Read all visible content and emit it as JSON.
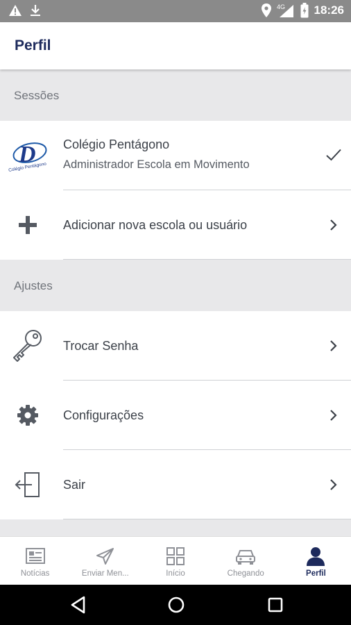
{
  "status_bar": {
    "time": "18:26",
    "network": "4G"
  },
  "app_bar": {
    "title": "Perfil"
  },
  "sections": {
    "sessions_header": "Sessões",
    "settings_header": "Ajustes"
  },
  "session": {
    "logo_alt": "Colégio Pentágono",
    "school_name": "Colégio Pentágono",
    "role": "Administrador Escola em Movimento"
  },
  "add_school": {
    "label": "Adicionar nova escola ou usuário"
  },
  "settings_items": [
    {
      "label": "Trocar Senha",
      "icon": "key-icon"
    },
    {
      "label": "Configurações",
      "icon": "gear-icon"
    },
    {
      "label": "Sair",
      "icon": "logout-icon"
    }
  ],
  "bottom_nav": [
    {
      "label": "Notícias",
      "icon": "newspaper-icon"
    },
    {
      "label": "Enviar Men...",
      "icon": "send-icon"
    },
    {
      "label": "Início",
      "icon": "grid-icon"
    },
    {
      "label": "Chegando",
      "icon": "car-icon"
    },
    {
      "label": "Perfil",
      "icon": "person-icon",
      "active": true
    }
  ],
  "colors": {
    "primary": "#1d2a5c",
    "section_bg": "#e8e8ea",
    "status_bar": "#8a8a8a"
  }
}
